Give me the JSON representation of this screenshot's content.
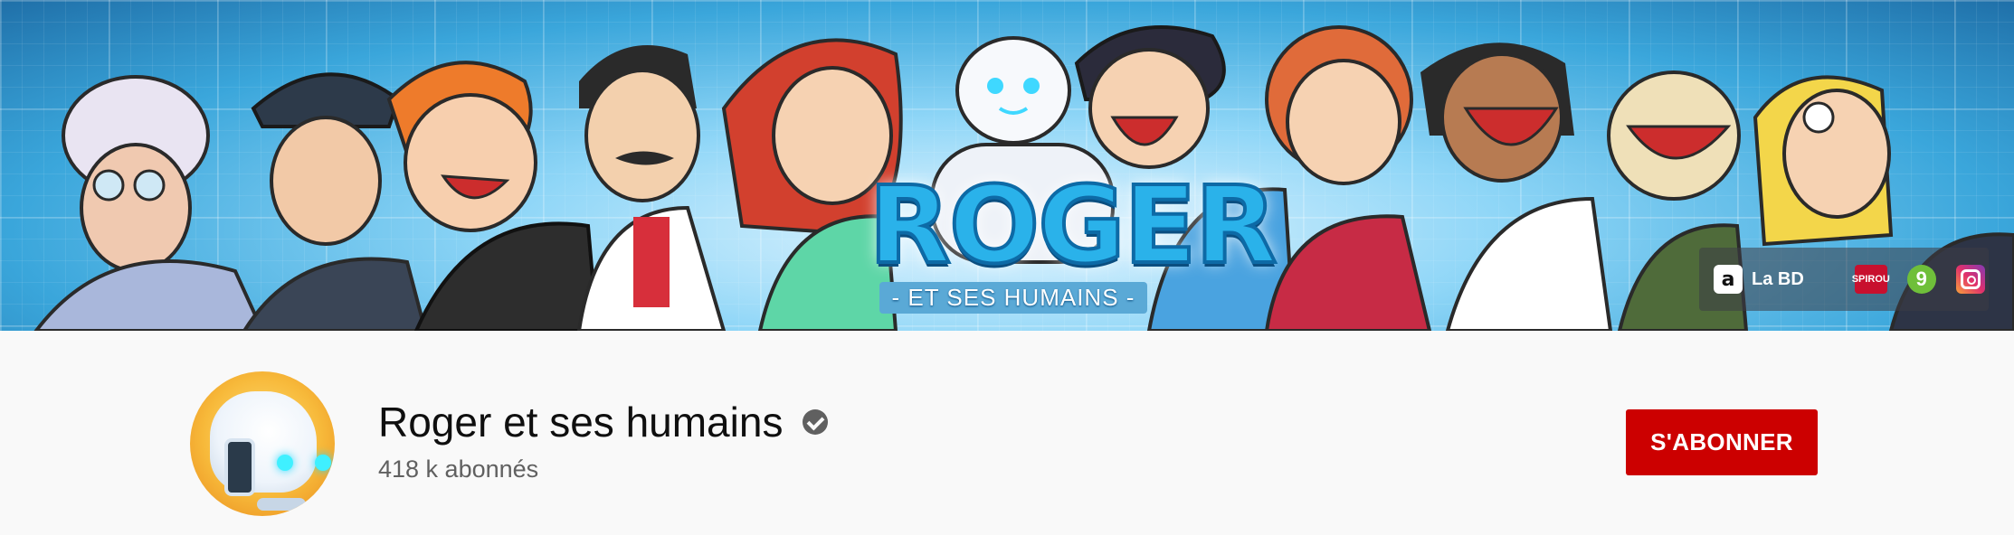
{
  "banner": {
    "logo_title": "ROGER",
    "logo_subtitle": "- ET SES HUMAINS -",
    "links": [
      {
        "icon": "amazon-icon",
        "label": "La BD"
      },
      {
        "icon": "spirou-icon",
        "label": "SPIROU"
      },
      {
        "icon": "nine-icon",
        "label": "9"
      },
      {
        "icon": "instagram-icon",
        "label": ""
      }
    ]
  },
  "channel": {
    "name": "Roger et ses humains",
    "verified_icon": "verified-check-icon",
    "subscribers": "418 k abonnés",
    "subscribe_label": "S'ABONNER"
  },
  "colors": {
    "subscribe_red": "#cc0000",
    "banner_blue": "#3aa6db",
    "text_secondary": "#606060"
  }
}
